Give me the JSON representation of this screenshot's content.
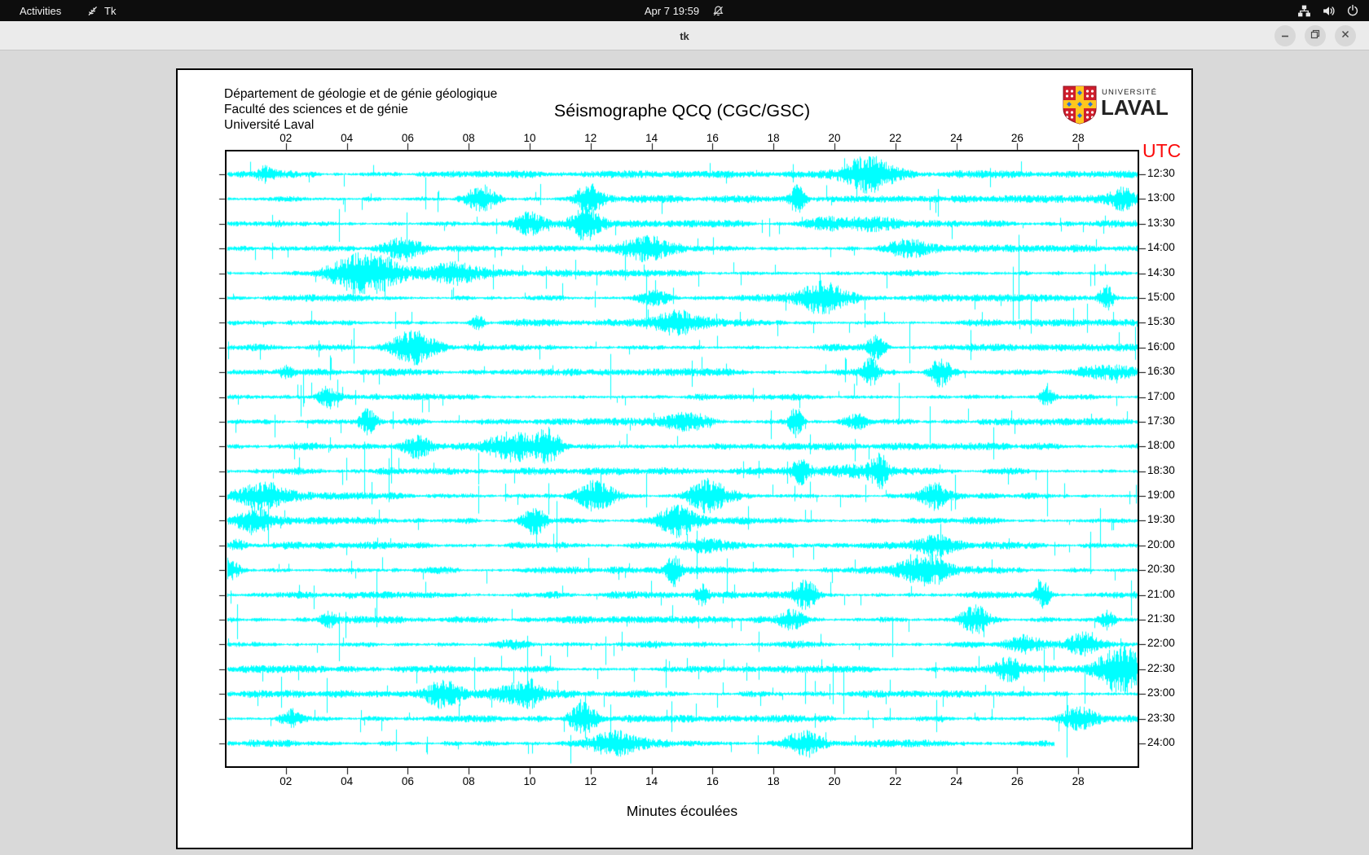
{
  "top_bar": {
    "activities_label": "Activities",
    "app_indicator": {
      "icon": "tk-icon",
      "label": "Tk"
    },
    "clock": "Apr 7  19:59",
    "status_icons": [
      "notifications-off-icon",
      "network-wired-icon",
      "volume-icon",
      "power-icon"
    ]
  },
  "window": {
    "title": "tk",
    "controls": [
      "minimize",
      "maximize",
      "close"
    ]
  },
  "seismograph": {
    "institution_lines": [
      "Département de géologie et de génie géologique",
      "Faculté des sciences et de génie",
      "Université Laval"
    ],
    "title": "Séismographe QCQ (CGC/GSC)",
    "logo": {
      "top": "UNIVERSITÉ",
      "bottom": "LAVAL"
    },
    "utc_label": "UTC",
    "x_axis_label": "Minutes écoulées",
    "x_tick_labels": [
      "02",
      "04",
      "06",
      "08",
      "10",
      "12",
      "14",
      "16",
      "18",
      "20",
      "22",
      "24",
      "26",
      "28"
    ],
    "time_labels": [
      "12:30",
      "13:00",
      "13:30",
      "14:00",
      "14:30",
      "15:00",
      "15:30",
      "16:00",
      "16:30",
      "17:00",
      "17:30",
      "18:00",
      "18:30",
      "19:00",
      "19:30",
      "20:00",
      "20:30",
      "21:00",
      "21:30",
      "22:00",
      "22:30",
      "23:00",
      "23:30",
      "24:00"
    ],
    "colors": {
      "trace": "#00ffff",
      "utc_label": "#fb0a0a",
      "axis": "#000000",
      "logo_red": "#cf1e2c",
      "logo_yellow": "#ffc61e",
      "logo_blue": "#2a6fd6"
    }
  },
  "chart_data": {
    "type": "line",
    "subtype": "helicorder-seismogram",
    "station": "QCQ (CGC/GSC)",
    "title": "Séismographe QCQ (CGC/GSC)",
    "xlabel": "Minutes écoulées",
    "x_range_minutes": [
      0,
      30
    ],
    "x_tick_interval_minutes": 2,
    "rows": 24,
    "row_interval_minutes": 30,
    "first_row_utc": "12:30",
    "last_row_utc": "24:00",
    "last_row_end_minute": 27.2,
    "trace_color": "#00ffff",
    "grid": false,
    "note": "Continuous cyan seismic noise traces with random spikes; amplitudes are not numerically labeled on the plot."
  }
}
